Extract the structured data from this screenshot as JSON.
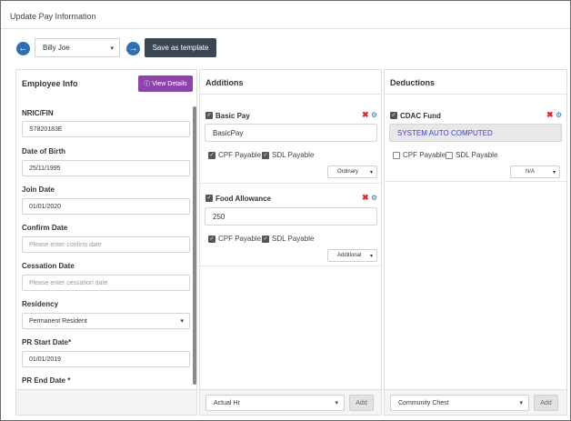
{
  "page_title": "Update Pay Information",
  "toolbar": {
    "employee_selected": "Billy Joe",
    "save_template_label": "Save as template"
  },
  "employee_info": {
    "title": "Employee Info",
    "view_details_label": "View Details",
    "fields": {
      "nric_label": "NRIC/FIN",
      "nric_value": "S7820183E",
      "dob_label": "Date of Birth",
      "dob_value": "25/11/1995",
      "join_label": "Join Date",
      "join_value": "01/01/2020",
      "confirm_label": "Confirm Date",
      "confirm_placeholder": "Please enter confirm date",
      "cessation_label": "Cessation Date",
      "cessation_placeholder": "Please enter cessation date",
      "residency_label": "Residency",
      "residency_value": "Permanent Resident",
      "pr_start_label": "PR Start Date*",
      "pr_start_value": "01/01/2019",
      "pr_end_label": "PR End Date *"
    }
  },
  "additions": {
    "title": "Additions",
    "items": [
      {
        "name": "Basic Pay",
        "value": "BasicPay",
        "cpf_label": "CPF Payable",
        "sdl_label": "SDL Payable",
        "type": "Ordinary"
      },
      {
        "name": "Food Allowance",
        "value": "250",
        "cpf_label": "CPF Payable",
        "sdl_label": "SDL Payable",
        "type": "Additional"
      }
    ],
    "footer_select": "Actual Hr",
    "add_label": "Add"
  },
  "deductions": {
    "title": "Deductions",
    "items": [
      {
        "name": "CDAC Fund",
        "value": "SYSTEM AUTO COMPUTED",
        "cpf_label": "CPF Payable",
        "sdl_label": "SDL Payable",
        "type": "N/A"
      }
    ],
    "footer_select": "Community Chest",
    "add_label": "Add"
  },
  "colors": {
    "nav_blue": "#2f6fb3",
    "dark_button": "#3a4652",
    "purple_button": "#8e44ad",
    "remove_red": "#d9262c",
    "auto_text": "#3b3bd6"
  },
  "icons": {
    "prev": "arrow-left-circle-icon",
    "next": "arrow-right-circle-icon",
    "info": "info-circle-icon",
    "remove": "close-x-icon",
    "settings": "gear-icon",
    "dropdown": "chevron-down-icon"
  }
}
